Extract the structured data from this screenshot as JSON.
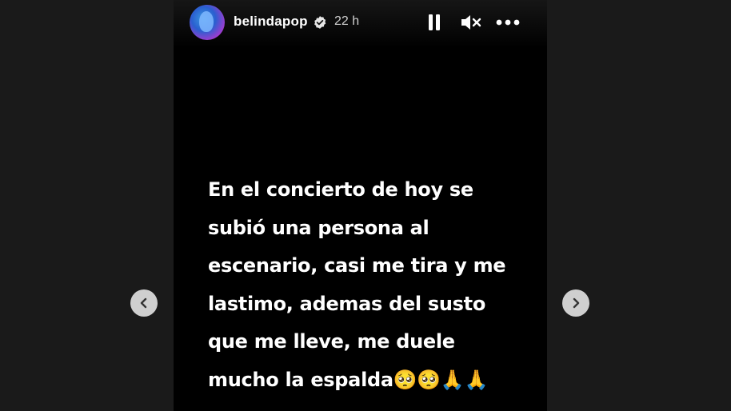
{
  "story": {
    "username": "belindapop",
    "time": "22 h",
    "text": "En el concierto de hoy se subió una persona al escenario, casi me tira y me lastimo, ademas del susto que me lleve, me duele mucho la espalda🥺🥺🙏🙏"
  },
  "controls": {
    "pause": "pause-icon",
    "mute": "muted-speaker-icon",
    "more": "more-horizontal-icon",
    "prev": "chevron-left-icon",
    "next": "chevron-right-icon"
  },
  "colors": {
    "background": "#1a1a1a",
    "story_bg": "#000000",
    "text": "#ffffff",
    "nav_button": "#cfcfcf"
  }
}
